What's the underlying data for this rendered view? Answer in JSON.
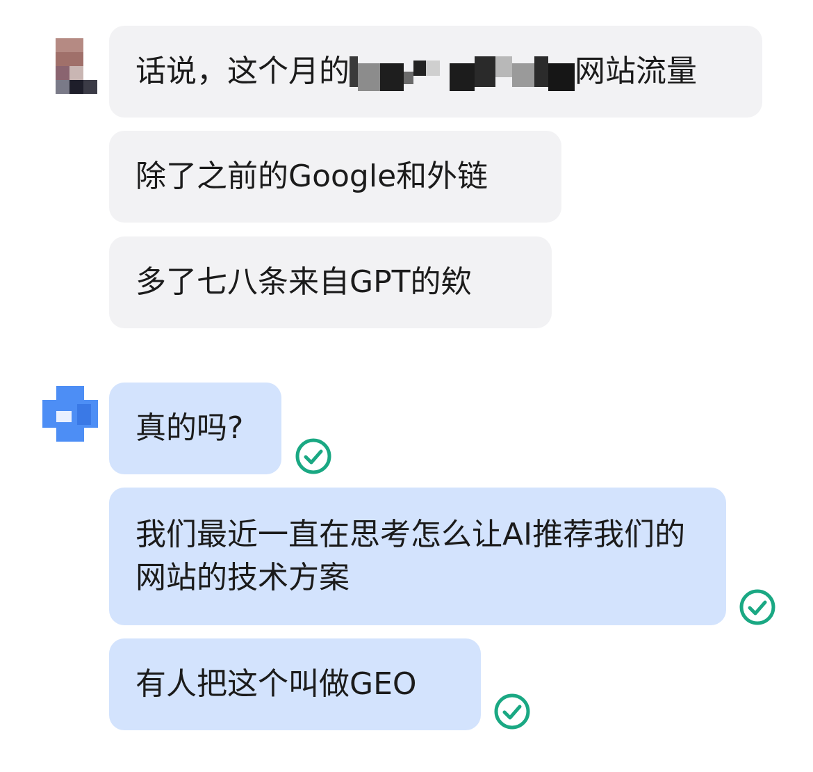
{
  "messages": [
    {
      "side": "in",
      "text_before": "话说，这个月的",
      "text_after": "网站流量",
      "redacted": true
    },
    {
      "side": "in",
      "text": "除了之前的Google和外链"
    },
    {
      "side": "in",
      "text": "多了七八条来自GPT的欸"
    },
    {
      "side": "out",
      "text": "真的吗?",
      "status_icon": "read-check-icon"
    },
    {
      "side": "out",
      "text": "我们最近一直在思考怎么让AI推荐我们的网站的技术方案",
      "status_icon": "read-check-icon"
    },
    {
      "side": "out",
      "text": "有人把这个叫做GEO",
      "status_icon": "read-check-icon"
    }
  ],
  "colors": {
    "incoming_bubble": "#f2f2f4",
    "outgoing_bubble": "#d3e3fd",
    "check": "#1aa883",
    "outgoing_avatar": "#4d8ef5"
  }
}
